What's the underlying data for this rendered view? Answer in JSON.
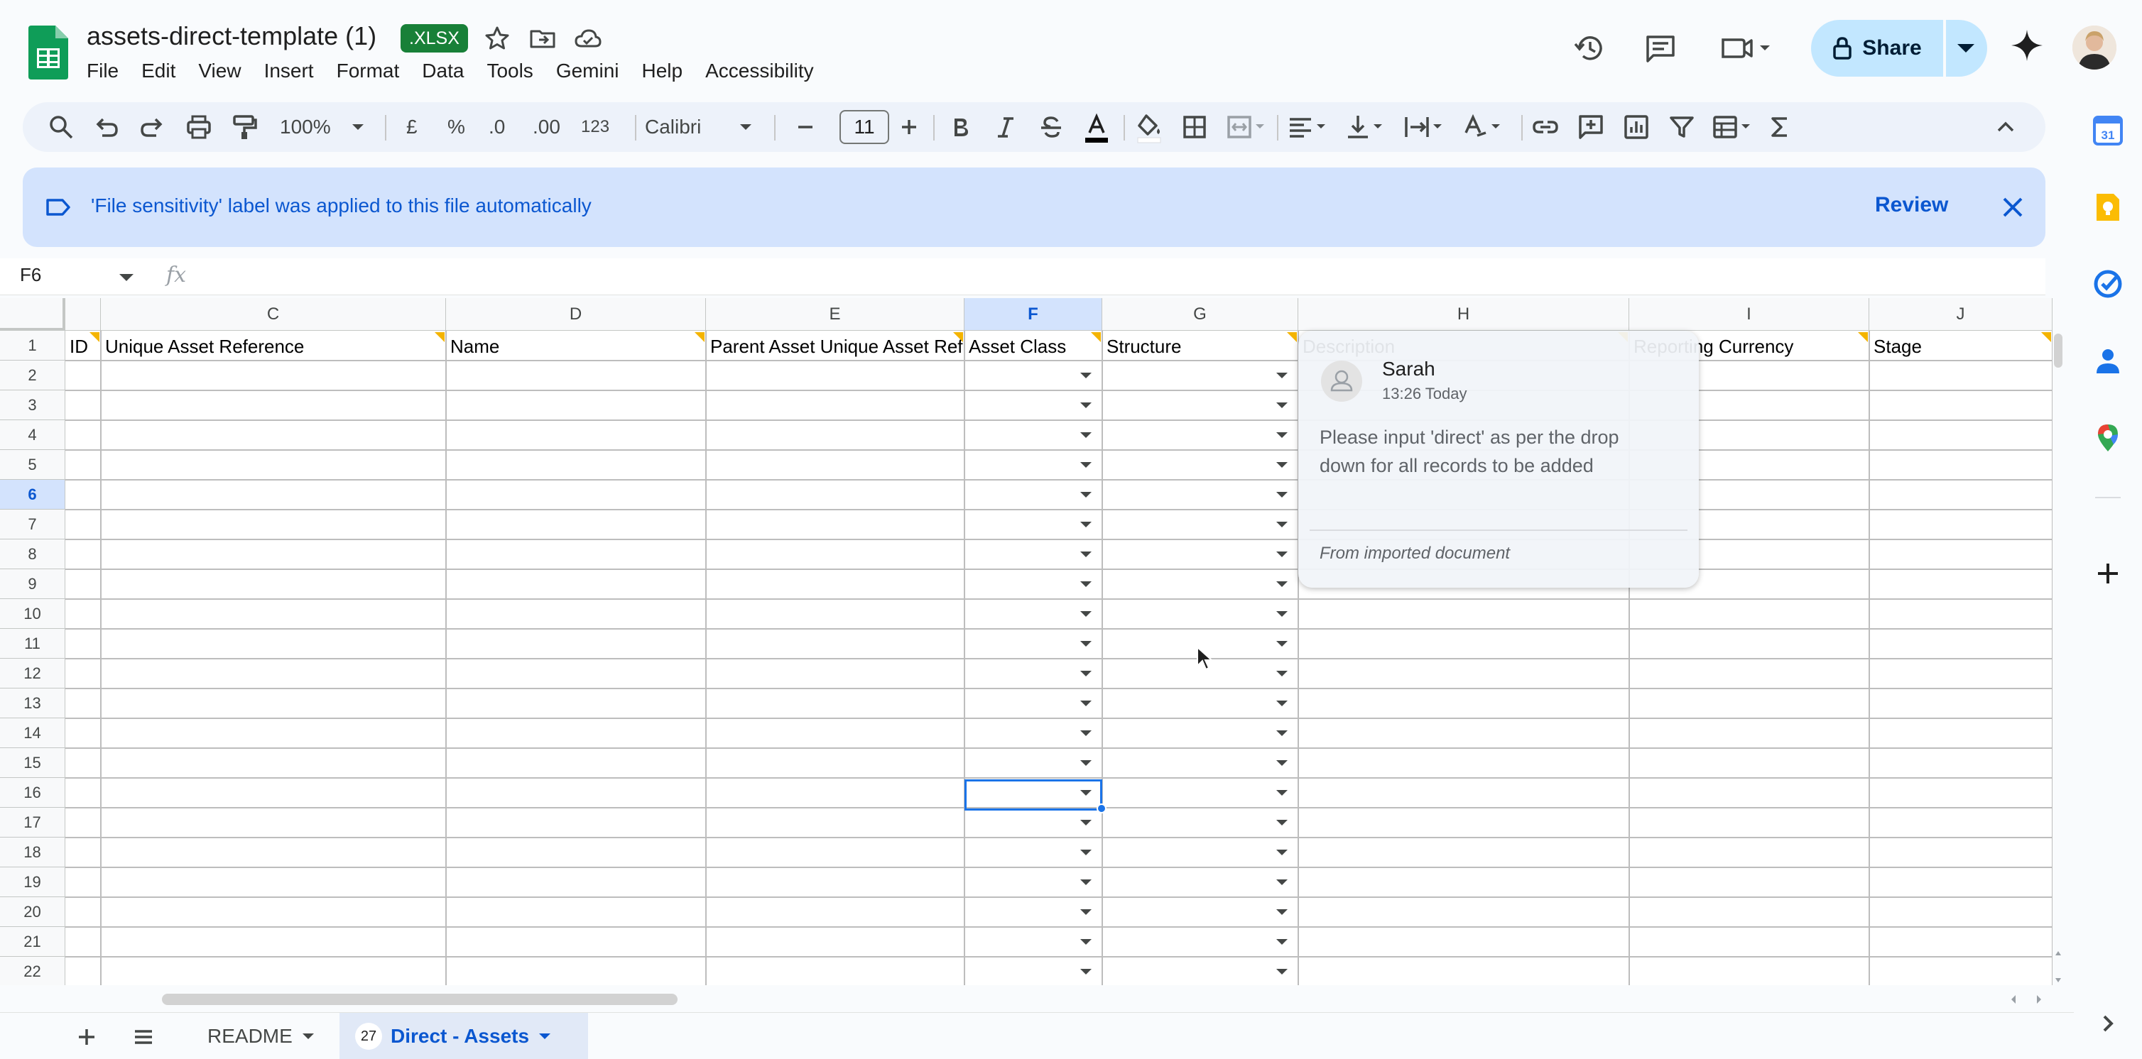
{
  "header": {
    "doc_title": "assets-direct-template (1)",
    "file_badge": ".XLSX",
    "menus": [
      "File",
      "Edit",
      "View",
      "Insert",
      "Format",
      "Data",
      "Tools",
      "Gemini",
      "Help",
      "Accessibility"
    ],
    "share_label": "Share"
  },
  "toolbar": {
    "zoom": "100%",
    "currency": "£",
    "percent": "%",
    "dec_decrease": ".0",
    "dec_increase": ".00",
    "number_format": "123",
    "font": "Calibri",
    "font_size": "11"
  },
  "banner": {
    "message": "'File sensitivity' label was applied to this file automatically",
    "action": "Review"
  },
  "formula_bar": {
    "cell_ref": "F6",
    "fx": "fx",
    "value": ""
  },
  "grid": {
    "column_headers": [
      "C",
      "D",
      "E",
      "F",
      "G",
      "H",
      "I",
      "J"
    ],
    "selected_column": "F",
    "row_numbers": [
      "1",
      "2",
      "3",
      "4",
      "5",
      "6",
      "7",
      "8",
      "9",
      "10",
      "11",
      "12",
      "13",
      "14",
      "15",
      "16",
      "17",
      "18",
      "19",
      "20",
      "21",
      "22"
    ],
    "selected_row": "6",
    "header_row": [
      "ID",
      "Unique Asset Reference",
      "Name",
      "Parent Asset Unique Asset Ref",
      "Asset Class",
      "Structure",
      "Description",
      "Reporting Currency",
      "Stage"
    ]
  },
  "comment": {
    "author": "Sarah",
    "time": "13:26 Today",
    "body": "Please input 'direct' as per the drop down for all records to be added",
    "footer": "From imported document"
  },
  "sheet_tabs": [
    {
      "label": "README",
      "active": false
    },
    {
      "label": "Direct - Assets",
      "active": true,
      "badge": "27"
    }
  ],
  "colors": {
    "accent": "#0b57d0",
    "share_bg": "#c2e7ff",
    "banner_bg": "#d3e3fd",
    "sheets_green": "#188038",
    "comment_marker": "#f4b400"
  },
  "icons": [
    "sheets-logo-icon",
    "star-icon",
    "move-folder-icon",
    "cloud-status-icon",
    "history-icon",
    "comment-icon",
    "meet-icon",
    "lock-icon",
    "gemini-spark-icon",
    "search-icon",
    "undo-icon",
    "redo-icon",
    "print-icon",
    "paint-format-icon",
    "bold-icon",
    "italic-icon",
    "strikethrough-icon",
    "text-color-icon",
    "fill-color-icon",
    "borders-icon",
    "merge-icon",
    "align-icon",
    "valign-icon",
    "wrap-icon",
    "rotate-icon",
    "link-icon",
    "add-comment-icon",
    "chart-icon",
    "filter-icon",
    "table-icon",
    "sum-icon",
    "collapse-icon",
    "label-icon",
    "close-icon",
    "calendar-icon",
    "keep-icon",
    "tasks-icon",
    "contacts-icon",
    "maps-icon",
    "plus-icon"
  ]
}
